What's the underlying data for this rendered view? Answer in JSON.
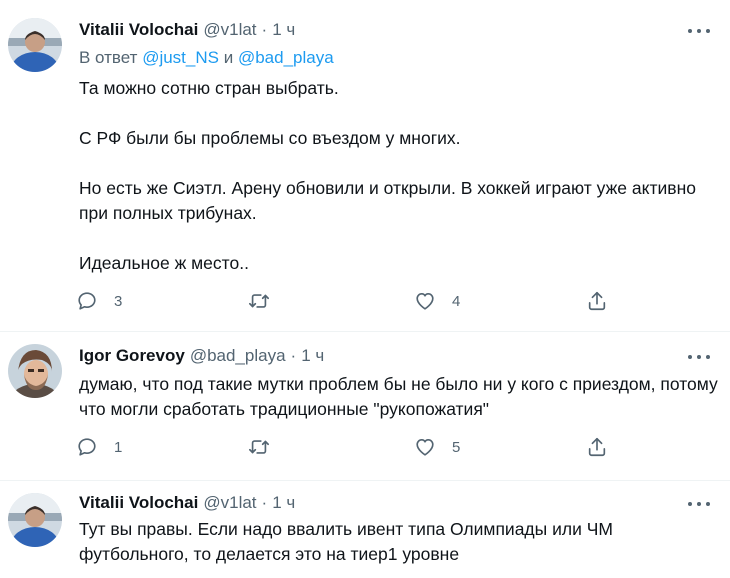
{
  "tweets": [
    {
      "author_name": "Vitalii Volochai",
      "author_handle": "@v1lat",
      "dot": "·",
      "time": "1 ч",
      "reply_prefix": "В ответ",
      "reply_handle_1": "@just_NS",
      "reply_joiner": "и",
      "reply_handle_2": "@bad_playa",
      "paragraphs": [
        "Та можно сотню стран выбрать.",
        "С РФ были бы проблемы со въездом у многих.",
        "Но есть же Сиэтл. Арену обновили и открыли. В хоккей играют уже активно при полных трибунах.",
        "Идеальное ж место.."
      ],
      "reply_count": "3",
      "retweet_count": "",
      "like_count": "4"
    },
    {
      "author_name": "Igor Gorevoy",
      "author_handle": "@bad_playa",
      "dot": "·",
      "time": "1 ч",
      "text": "думаю, что под такие мутки проблем бы не было ни у кого с приездом, потому что могли сработать традиционные \"рукопожатия\"",
      "reply_count": "1",
      "retweet_count": "",
      "like_count": "5"
    },
    {
      "author_name": "Vitalii Volochai",
      "author_handle": "@v1lat",
      "dot": "·",
      "time": "1 ч",
      "text": "Тут вы правы. Если надо ввалить ивент типа Олимпиады или ЧМ футбольного, то делается это на тиер1 уровне"
    }
  ],
  "icons": {
    "reply": "reply-icon",
    "retweet": "retweet-icon",
    "like": "heart-icon",
    "share": "share-icon",
    "more": "more-icon"
  },
  "colors": {
    "link": "#1d9bf0",
    "secondary_text": "#536471",
    "primary_text": "#0f1419",
    "divider": "#eff3f4"
  }
}
